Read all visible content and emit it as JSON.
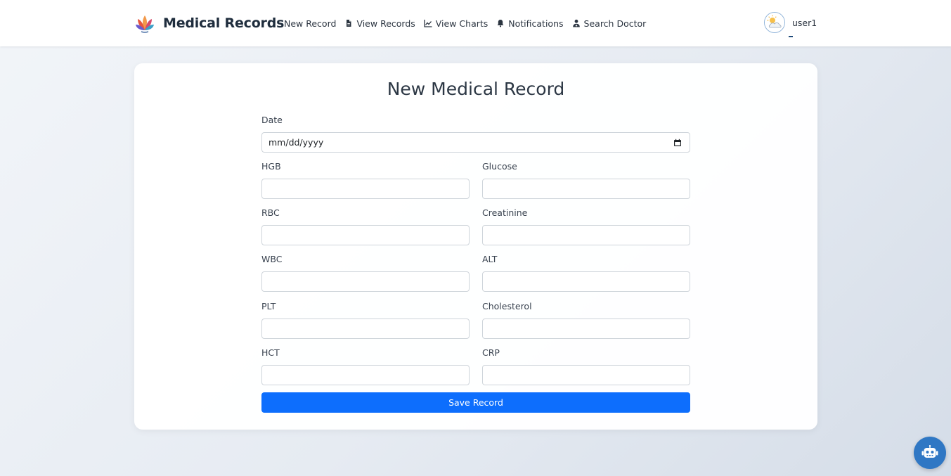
{
  "brand": {
    "name": "Medical Records"
  },
  "nav": {
    "items": [
      {
        "label": "New Record",
        "icon": "none"
      },
      {
        "label": "View Records",
        "icon": "file-icon"
      },
      {
        "label": "View Charts",
        "icon": "chart-line-icon"
      },
      {
        "label": "Notifications",
        "icon": "bell-icon"
      },
      {
        "label": "Search Doctor",
        "icon": "user-doctor-icon"
      }
    ]
  },
  "user": {
    "name": "user1",
    "avatar": "weather-avatar"
  },
  "form": {
    "title": "New Medical Record",
    "date": {
      "label": "Date",
      "value": "mm/dd/yyyy"
    },
    "fields": {
      "hgb": {
        "label": "HGB",
        "value": ""
      },
      "glucose": {
        "label": "Glucose",
        "value": ""
      },
      "rbc": {
        "label": "RBC",
        "value": ""
      },
      "creatinine": {
        "label": "Creatinine",
        "value": ""
      },
      "wbc": {
        "label": "WBC",
        "value": ""
      },
      "alt": {
        "label": "ALT",
        "value": ""
      },
      "plt": {
        "label": "PLT",
        "value": ""
      },
      "cholesterol": {
        "label": "Cholesterol",
        "value": ""
      },
      "hct": {
        "label": "HCT",
        "value": ""
      },
      "crp": {
        "label": "CRP",
        "value": ""
      }
    },
    "submit_label": "Save Record"
  },
  "chatbot": {
    "icon": "robot-icon"
  },
  "colors": {
    "primary": "#0d6efd",
    "chat": "#2f77c4",
    "title": "#2c3744"
  }
}
